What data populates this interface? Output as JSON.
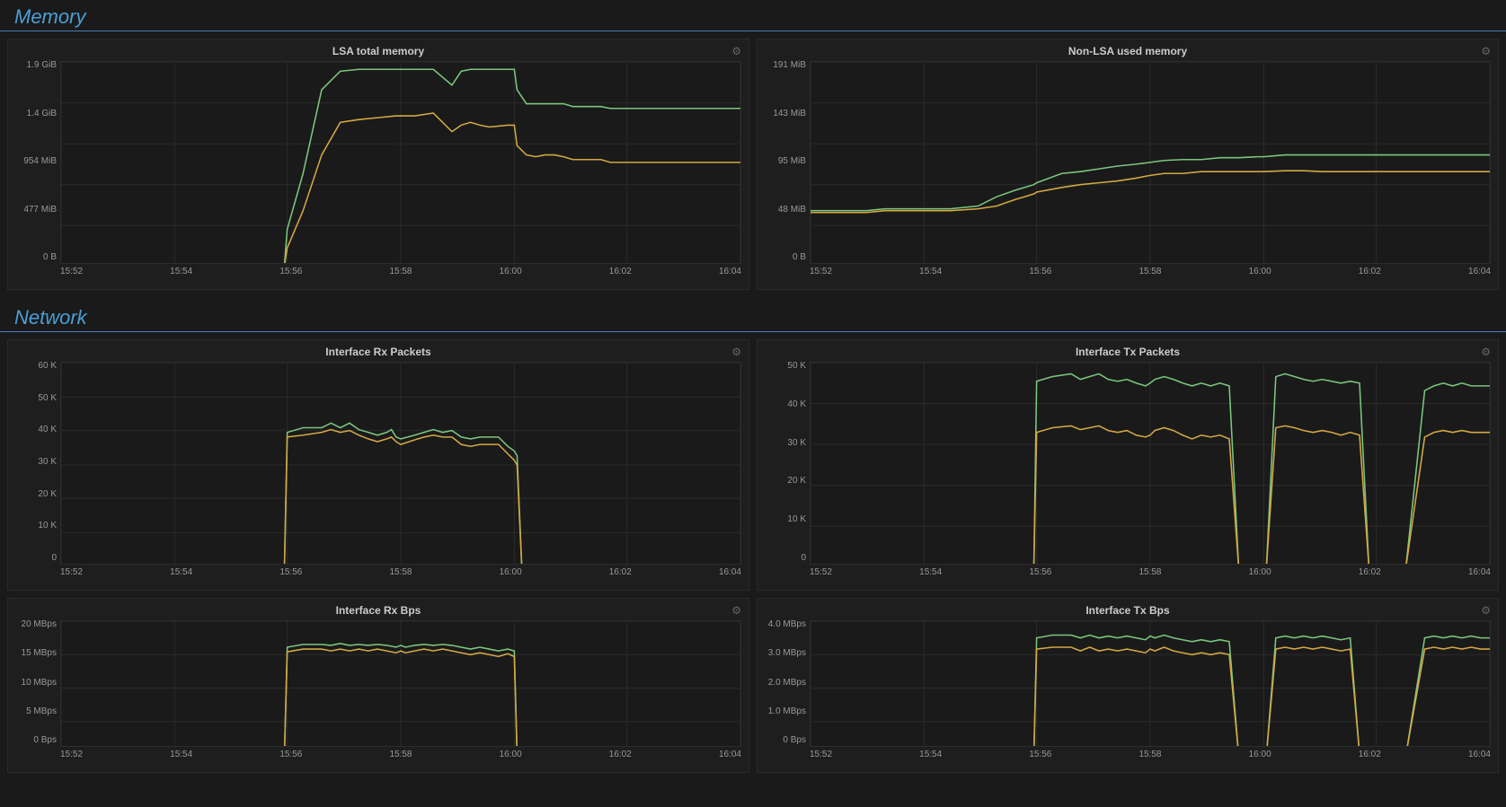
{
  "memory": {
    "title": "Memory",
    "charts": [
      {
        "id": "lsa-total-memory",
        "title": "LSA total memory",
        "yLabels": [
          "1.9 GiB",
          "1.4 GiB",
          "954 MiB",
          "477 MiB",
          "0 B"
        ],
        "xLabels": [
          "15:52",
          "15:54",
          "15:56",
          "15:58",
          "16:00",
          "16:02",
          "16:04"
        ]
      },
      {
        "id": "non-lsa-used-memory",
        "title": "Non-LSA used memory",
        "yLabels": [
          "191 MiB",
          "143 MiB",
          "95 MiB",
          "48 MiB",
          "0 B"
        ],
        "xLabels": [
          "15:52",
          "15:54",
          "15:56",
          "15:58",
          "16:00",
          "16:02",
          "16:04"
        ]
      }
    ]
  },
  "network": {
    "title": "Network",
    "charts": [
      {
        "id": "interface-rx-packets",
        "title": "Interface Rx Packets",
        "yLabels": [
          "60 K",
          "50 K",
          "40 K",
          "30 K",
          "20 K",
          "10 K",
          "0"
        ],
        "xLabels": [
          "15:52",
          "15:54",
          "15:56",
          "15:58",
          "16:00",
          "16:02",
          "16:04"
        ]
      },
      {
        "id": "interface-tx-packets",
        "title": "Interface Tx Packets",
        "yLabels": [
          "50 K",
          "40 K",
          "30 K",
          "20 K",
          "10 K",
          "0"
        ],
        "xLabels": [
          "15:52",
          "15:54",
          "15:56",
          "15:58",
          "16:00",
          "16:02",
          "16:04"
        ]
      },
      {
        "id": "interface-rx-bps",
        "title": "Interface Rx Bps",
        "yLabels": [
          "20 MBps",
          "15 MBps",
          "10 MBps",
          "5 MBps",
          "0 Bps"
        ],
        "xLabels": [
          "15:52",
          "15:54",
          "15:56",
          "15:58",
          "16:00",
          "16:02",
          "16:04"
        ]
      },
      {
        "id": "interface-tx-bps",
        "title": "Interface Tx Bps",
        "yLabels": [
          "4.0 MBps",
          "3.0 MBps",
          "2.0 MBps",
          "1.0 MBps",
          "0 Bps"
        ],
        "xLabels": [
          "15:52",
          "15:54",
          "15:56",
          "15:58",
          "16:00",
          "16:02",
          "16:04"
        ]
      }
    ]
  },
  "colors": {
    "green": "#7bc67e",
    "yellow": "#d4a843",
    "background": "#1a1a1a",
    "grid": "#2a2a2a",
    "accent": "#4a9fd4"
  }
}
